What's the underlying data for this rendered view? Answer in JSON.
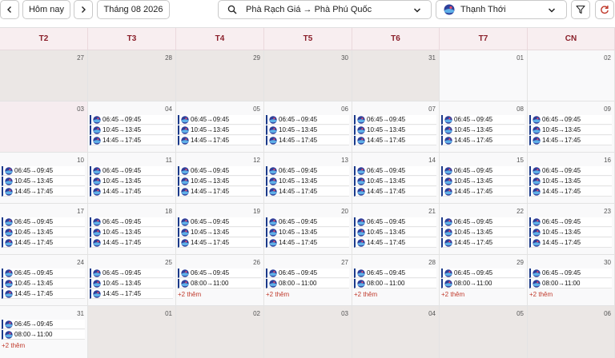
{
  "toolbar": {
    "prev_icon": "chevron-left-icon",
    "today_label": "Hôm nay",
    "next_icon": "chevron-right-icon",
    "month_label": "Tháng 08 2026",
    "route": "Phà Rạch Giá → Phà Phú Quốc",
    "operator": "Thạnh Thới",
    "filter_icon": "filter-icon",
    "refresh_icon": "refresh-icon"
  },
  "colors": {
    "header_text": "#8a1f2a",
    "more_link": "#c0392b",
    "trip_accent": "#1b3a8a"
  },
  "weekdays": [
    "T2",
    "T3",
    "T4",
    "T5",
    "T6",
    "T7",
    "CN"
  ],
  "weeks": [
    [
      {
        "day": "27",
        "state": "outside",
        "trips": [],
        "more": ""
      },
      {
        "day": "28",
        "state": "outside",
        "trips": [],
        "more": ""
      },
      {
        "day": "29",
        "state": "outside",
        "trips": [],
        "more": ""
      },
      {
        "day": "30",
        "state": "outside",
        "trips": [],
        "more": ""
      },
      {
        "day": "31",
        "state": "outside",
        "trips": [],
        "more": ""
      },
      {
        "day": "01",
        "state": "normal",
        "trips": [],
        "more": ""
      },
      {
        "day": "02",
        "state": "normal",
        "trips": [],
        "more": ""
      }
    ],
    [
      {
        "day": "03",
        "state": "past",
        "trips": [],
        "more": ""
      },
      {
        "day": "04",
        "state": "normal",
        "trips": [
          "06:45→09:45",
          "10:45→13:45",
          "14:45→17:45"
        ],
        "more": ""
      },
      {
        "day": "05",
        "state": "normal",
        "trips": [
          "06:45→09:45",
          "10:45→13:45",
          "14:45→17:45"
        ],
        "more": ""
      },
      {
        "day": "06",
        "state": "normal",
        "trips": [
          "06:45→09:45",
          "10:45→13:45",
          "14:45→17:45"
        ],
        "more": ""
      },
      {
        "day": "07",
        "state": "normal",
        "trips": [
          "06:45→09:45",
          "10:45→13:45",
          "14:45→17:45"
        ],
        "more": ""
      },
      {
        "day": "08",
        "state": "normal",
        "trips": [
          "06:45→09:45",
          "10:45→13:45",
          "14:45→17:45"
        ],
        "more": ""
      },
      {
        "day": "09",
        "state": "normal",
        "trips": [
          "06:45→09:45",
          "10:45→13:45",
          "14:45→17:45"
        ],
        "more": ""
      }
    ],
    [
      {
        "day": "10",
        "state": "normal",
        "trips": [
          "06:45→09:45",
          "10:45→13:45",
          "14:45→17:45"
        ],
        "more": ""
      },
      {
        "day": "11",
        "state": "normal",
        "trips": [
          "06:45→09:45",
          "10:45→13:45",
          "14:45→17:45"
        ],
        "more": ""
      },
      {
        "day": "12",
        "state": "normal",
        "trips": [
          "06:45→09:45",
          "10:45→13:45",
          "14:45→17:45"
        ],
        "more": ""
      },
      {
        "day": "13",
        "state": "normal",
        "trips": [
          "06:45→09:45",
          "10:45→13:45",
          "14:45→17:45"
        ],
        "more": ""
      },
      {
        "day": "14",
        "state": "normal",
        "trips": [
          "06:45→09:45",
          "10:45→13:45",
          "14:45→17:45"
        ],
        "more": ""
      },
      {
        "day": "15",
        "state": "normal",
        "trips": [
          "06:45→09:45",
          "10:45→13:45",
          "14:45→17:45"
        ],
        "more": ""
      },
      {
        "day": "16",
        "state": "normal",
        "trips": [
          "06:45→09:45",
          "10:45→13:45",
          "14:45→17:45"
        ],
        "more": ""
      }
    ],
    [
      {
        "day": "17",
        "state": "normal",
        "trips": [
          "06:45→09:45",
          "10:45→13:45",
          "14:45→17:45"
        ],
        "more": ""
      },
      {
        "day": "18",
        "state": "normal",
        "trips": [
          "06:45→09:45",
          "10:45→13:45",
          "14:45→17:45"
        ],
        "more": ""
      },
      {
        "day": "19",
        "state": "normal",
        "trips": [
          "06:45→09:45",
          "10:45→13:45",
          "14:45→17:45"
        ],
        "more": ""
      },
      {
        "day": "20",
        "state": "normal",
        "trips": [
          "06:45→09:45",
          "10:45→13:45",
          "14:45→17:45"
        ],
        "more": ""
      },
      {
        "day": "21",
        "state": "normal",
        "trips": [
          "06:45→09:45",
          "10:45→13:45",
          "14:45→17:45"
        ],
        "more": ""
      },
      {
        "day": "22",
        "state": "normal",
        "trips": [
          "06:45→09:45",
          "10:45→13:45",
          "14:45→17:45"
        ],
        "more": ""
      },
      {
        "day": "23",
        "state": "normal",
        "trips": [
          "06:45→09:45",
          "10:45→13:45",
          "14:45→17:45"
        ],
        "more": ""
      }
    ],
    [
      {
        "day": "24",
        "state": "normal",
        "trips": [
          "06:45→09:45",
          "10:45→13:45",
          "14:45→17:45"
        ],
        "more": ""
      },
      {
        "day": "25",
        "state": "normal",
        "trips": [
          "06:45→09:45",
          "10:45→13:45",
          "14:45→17:45"
        ],
        "more": ""
      },
      {
        "day": "26",
        "state": "normal",
        "trips": [
          "06:45→09:45",
          "08:00→11:00"
        ],
        "more": "+2 thêm"
      },
      {
        "day": "27",
        "state": "normal",
        "trips": [
          "06:45→09:45",
          "08:00→11:00"
        ],
        "more": "+2 thêm"
      },
      {
        "day": "28",
        "state": "normal",
        "trips": [
          "06:45→09:45",
          "08:00→11:00"
        ],
        "more": "+2 thêm"
      },
      {
        "day": "29",
        "state": "normal",
        "trips": [
          "06:45→09:45",
          "08:00→11:00"
        ],
        "more": "+2 thêm"
      },
      {
        "day": "30",
        "state": "normal",
        "trips": [
          "06:45→09:45",
          "08:00→11:00"
        ],
        "more": "+2 thêm"
      }
    ],
    [
      {
        "day": "31",
        "state": "normal",
        "trips": [
          "06:45→09:45",
          "08:00→11:00"
        ],
        "more": "+2 thêm"
      },
      {
        "day": "01",
        "state": "outside",
        "trips": [],
        "more": ""
      },
      {
        "day": "02",
        "state": "outside",
        "trips": [],
        "more": ""
      },
      {
        "day": "03",
        "state": "outside",
        "trips": [],
        "more": ""
      },
      {
        "day": "04",
        "state": "outside",
        "trips": [],
        "more": ""
      },
      {
        "day": "05",
        "state": "outside",
        "trips": [],
        "more": ""
      },
      {
        "day": "06",
        "state": "outside",
        "trips": [],
        "more": ""
      }
    ]
  ]
}
